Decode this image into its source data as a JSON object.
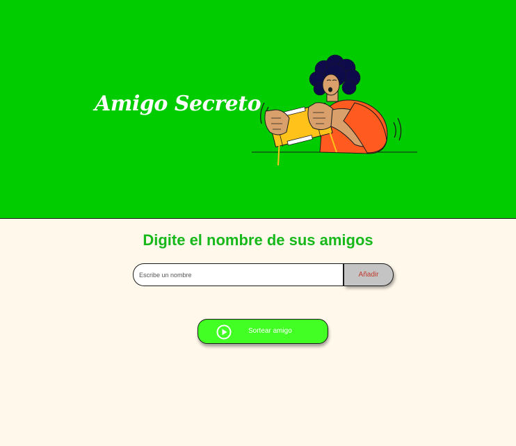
{
  "header": {
    "title": "Amigo Secreto",
    "background_color": "#00cc00",
    "illustration": "person-holding-gift-illustration"
  },
  "main": {
    "section_title": "Digite el nombre de sus amigos",
    "name_input": {
      "placeholder": "Escribe un nombre",
      "value": ""
    },
    "add_button_label": "Añadir",
    "draw_button": {
      "label": "Sortear amigo",
      "icon": "play-circle-icon"
    },
    "background_color": "#fff8eb",
    "accent_color": "#16b81a"
  }
}
